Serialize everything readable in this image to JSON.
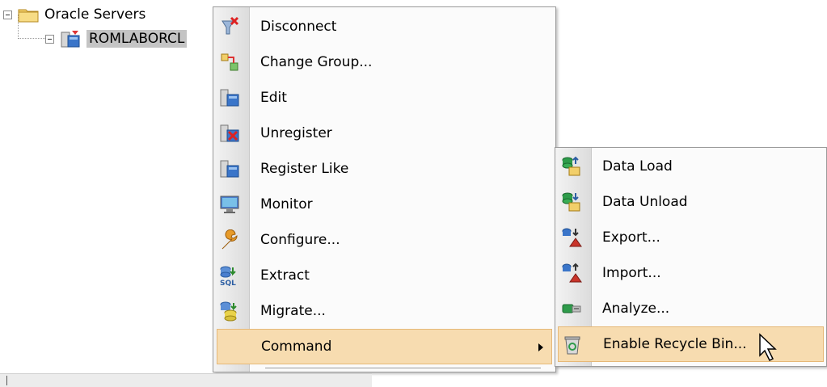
{
  "tree": {
    "root_label": "Oracle Servers",
    "child_label": "ROMLABORCL",
    "root_icon": "folder-icon",
    "child_icon": "server-icon"
  },
  "context_menu": {
    "items": [
      {
        "label": "Disconnect",
        "icon": "disconnect-icon"
      },
      {
        "label": "Change Group...",
        "icon": "change-group-icon"
      },
      {
        "label": "Edit",
        "icon": "edit-server-icon"
      },
      {
        "label": "Unregister",
        "icon": "unregister-icon"
      },
      {
        "label": "Register Like",
        "icon": "register-like-icon"
      },
      {
        "label": "Monitor",
        "icon": "monitor-icon"
      },
      {
        "label": "Configure...",
        "icon": "wrench-icon"
      },
      {
        "label": "Extract",
        "icon": "extract-sql-icon"
      },
      {
        "label": "Migrate...",
        "icon": "migrate-icon"
      },
      {
        "label": "Command",
        "icon": "",
        "highlighted": true,
        "submenu": true
      }
    ]
  },
  "submenu": {
    "items": [
      {
        "label": "Data Load",
        "icon": "data-load-icon"
      },
      {
        "label": "Data Unload",
        "icon": "data-unload-icon"
      },
      {
        "label": "Export...",
        "icon": "export-icon"
      },
      {
        "label": "Import...",
        "icon": "import-icon"
      },
      {
        "label": "Analyze...",
        "icon": "analyze-icon"
      },
      {
        "label": "Enable Recycle Bin...",
        "icon": "recycle-bin-icon",
        "highlighted": true
      }
    ]
  },
  "colors": {
    "highlight_bg": "#f7dcb0",
    "highlight_border": "#e6b877",
    "gutter": "#dcdcdc"
  }
}
